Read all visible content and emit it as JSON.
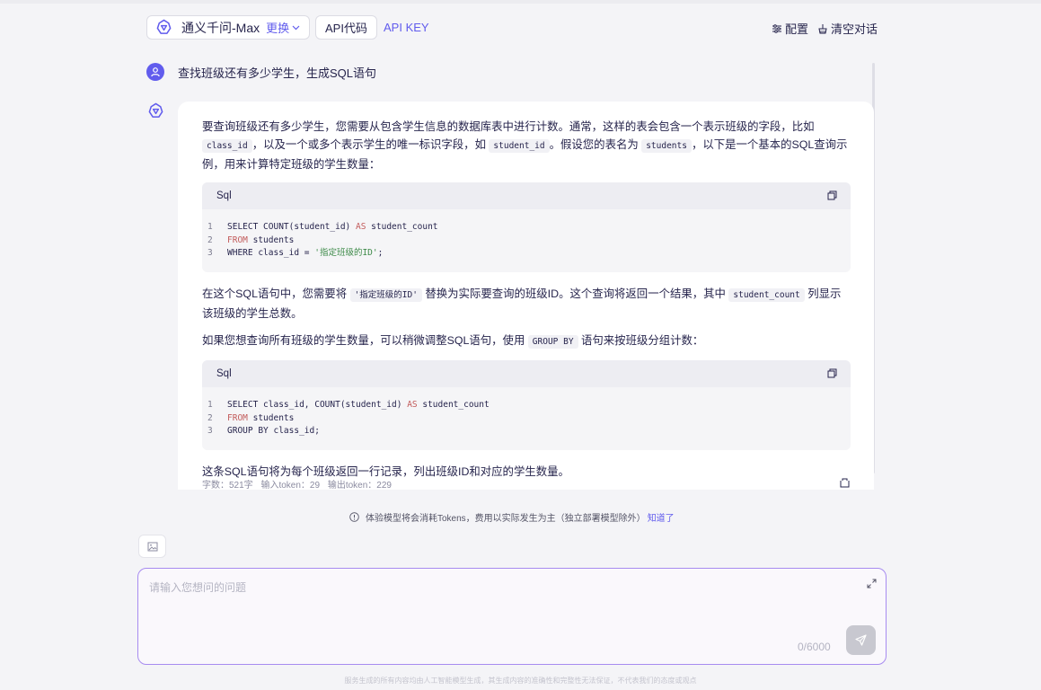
{
  "header": {
    "model_name": "通义千问-Max",
    "change_label": "更换",
    "api_code_label": "API代码",
    "api_key_label": "API KEY",
    "config_label": "配置",
    "clear_label": "清空对话"
  },
  "chat": {
    "user_question": "查找班级还有多少学生，生成SQL语句",
    "answer": {
      "p1_a": "要查询班级还有多少学生，您需要从包含学生信息的数据库表中进行计数。通常，这样的表会包含一个表示班级的字段，比如",
      "p1_code1": "class_id",
      "p1_b": "，以及一个或多个表示学生的唯一标识字段，如",
      "p1_code2": "student_id",
      "p1_c": "。假设您的表名为",
      "p1_code3": "students",
      "p1_d": "，以下是一个基本的SQL查询示例，用来计算特定班级的学生数量：",
      "code1": {
        "lang": "Sql",
        "lines": [
          {
            "n": "1",
            "kw": "",
            "t": "SELECT COUNT(student_id) ",
            "kw2": "AS",
            "t2": " student_count"
          },
          {
            "n": "2",
            "kw": "FROM",
            "t": " students",
            "kw2": "",
            "t2": ""
          },
          {
            "n": "3",
            "kw": "",
            "t": "WHERE class_id = ",
            "str": "'指定班级的ID'",
            "t2": ";"
          }
        ]
      },
      "p2_a": "在这个SQL语句中，您需要将",
      "p2_code1": "'指定班级的ID'",
      "p2_b": "替换为实际要查询的班级ID。这个查询将返回一个结果，其中",
      "p2_code2": "student_count",
      "p2_c": "列显示该班级的学生总数。",
      "p3_a": "如果您想查询所有班级的学生数量，可以稍微调整SQL语句，使用",
      "p3_code1": "GROUP BY",
      "p3_b": "语句来按班级分组计数：",
      "code2": {
        "lang": "Sql",
        "lines": [
          {
            "n": "1",
            "t": "SELECT class_id, COUNT(student_id) ",
            "kw2": "AS",
            "t2": " student_count"
          },
          {
            "n": "2",
            "kw": "FROM",
            "t": " students"
          },
          {
            "n": "3",
            "t": "GROUP BY class_id;"
          }
        ]
      },
      "p4": "这条SQL语句将为每个班级返回一行记录，列出班级ID和对应的学生数量。",
      "meta": {
        "chars": "字数：521字",
        "input_tokens": "输入token：29",
        "output_tokens": "输出token：229"
      }
    }
  },
  "notice": {
    "text": "体验模型将会消耗Tokens，费用以实际发生为主（独立部署模型除外）",
    "link": "知道了"
  },
  "input": {
    "placeholder": "请输入您想问的问题",
    "counter": "0/6000"
  },
  "footer": "服务生成的所有内容均由人工智能模型生成，其生成内容的准确性和完整性无法保证，不代表我们的态度或观点"
}
